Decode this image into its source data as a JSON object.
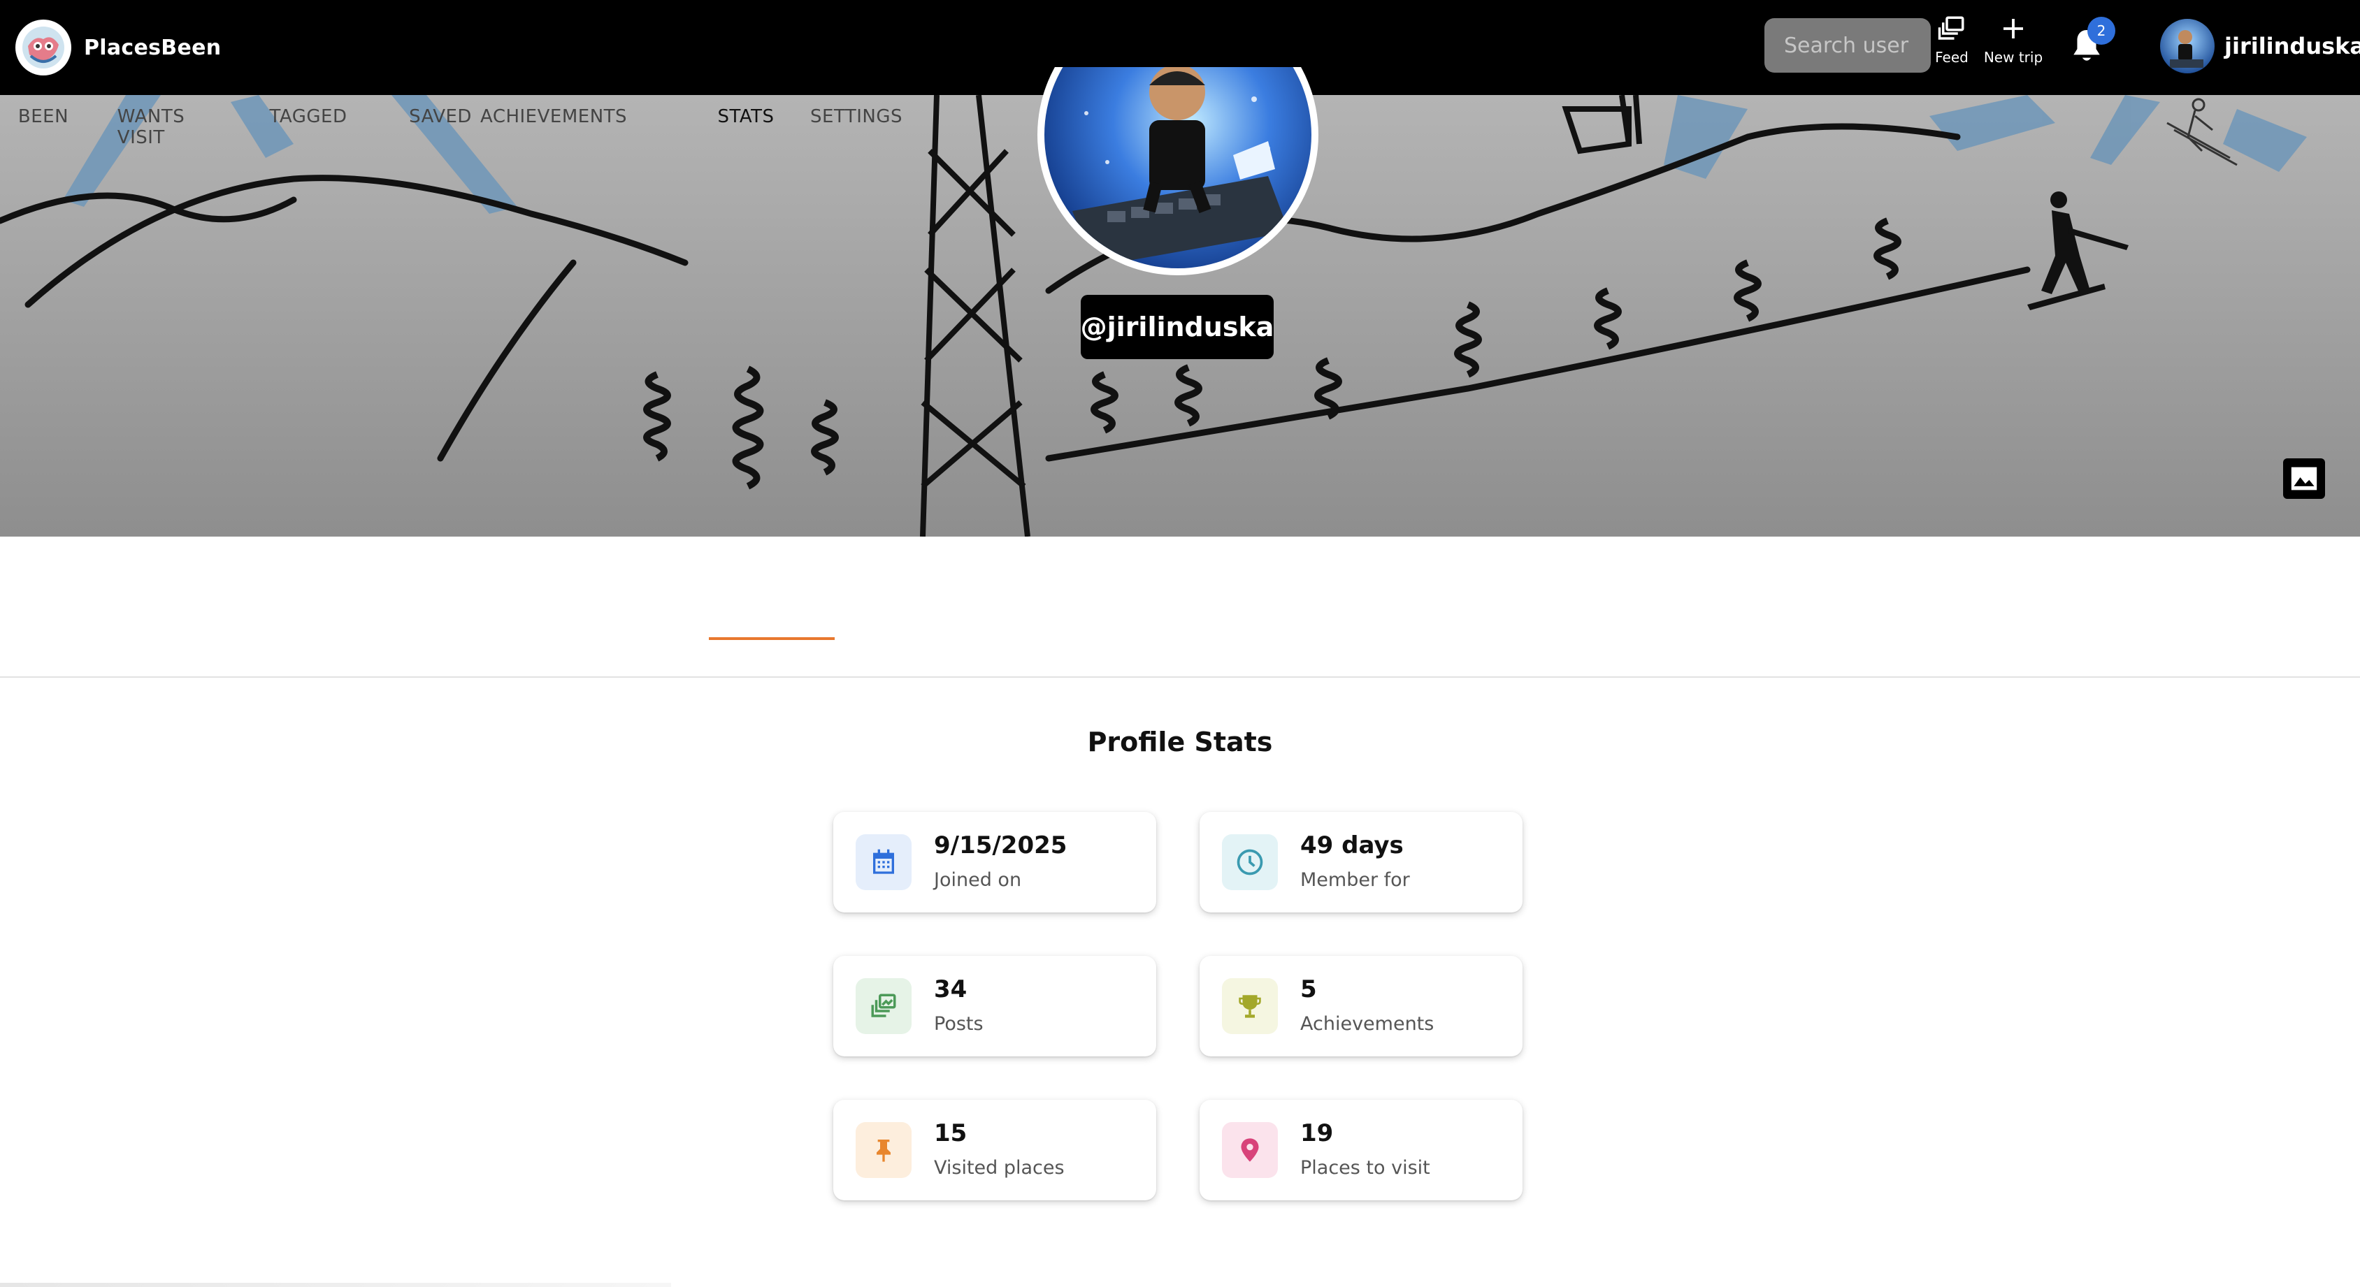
{
  "app": {
    "name": "PlacesBeen"
  },
  "header": {
    "search_placeholder": "Search user",
    "feed_label": "Feed",
    "new_trip_label": "New trip",
    "notification_count": "2",
    "username": "jirilinduska"
  },
  "profile": {
    "handle": "@jirilinduska"
  },
  "tabs": [
    {
      "label": "BEEN",
      "active": false
    },
    {
      "label": "WANTS VISIT",
      "active": false
    },
    {
      "label": "TAGGED",
      "active": false
    },
    {
      "label": "SAVED",
      "active": false
    },
    {
      "label": "ACHIEVEMENTS",
      "active": false
    },
    {
      "label": "STATS",
      "active": true
    },
    {
      "label": "SETTINGS",
      "active": false
    }
  ],
  "stats": {
    "title": "Profile Stats",
    "cards": [
      {
        "value": "9/15/2025",
        "label": "Joined on",
        "icon": "calendar-icon",
        "color": "#2f6fdb",
        "bg": "#e5eefb"
      },
      {
        "value": "49 days",
        "label": "Member for",
        "icon": "clock-icon",
        "color": "#3a9ab0",
        "bg": "#e3f3f6"
      },
      {
        "value": "34",
        "label": "Posts",
        "icon": "posts-icon",
        "color": "#4c9a58",
        "bg": "#e6f3e7"
      },
      {
        "value": "5",
        "label": "Achievements",
        "icon": "trophy-icon",
        "color": "#a3a82a",
        "bg": "#f5f6e1"
      },
      {
        "value": "15",
        "label": "Visited places",
        "icon": "pin-icon",
        "color": "#e8862e",
        "bg": "#fdeedd"
      },
      {
        "value": "19",
        "label": "Places to visit",
        "icon": "location-icon",
        "color": "#d8437a",
        "bg": "#fbe3ec"
      }
    ]
  },
  "colors": {
    "accent_tab": "#e8782e",
    "badge": "#2f6fdb",
    "topbar": "#000000"
  }
}
